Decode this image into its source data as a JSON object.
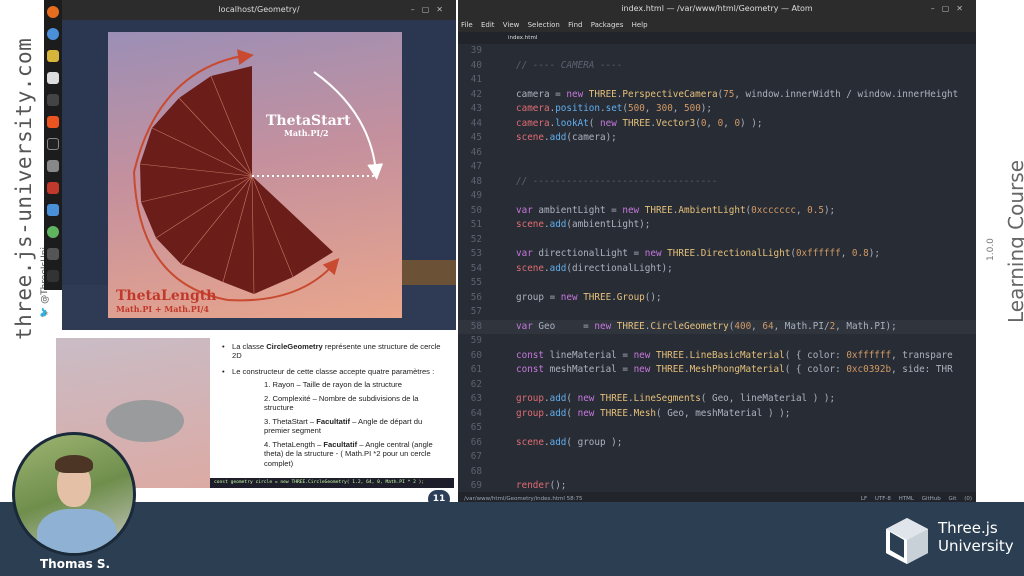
{
  "branding": {
    "left_site": "three.js-university.com",
    "left_handle": "@ThreeJsUni",
    "right_course": "Learning Course",
    "right_version": "1.0.0"
  },
  "browser": {
    "title": "localhost/Geometry/",
    "theta_start_label": "ThetaStart",
    "theta_start_value": "Math.PI/2",
    "theta_length_label": "ThetaLength",
    "theta_length_value": "Math.PI + Math.PI/4",
    "colors": {
      "mesh": "#6b1d19",
      "arrow_red": "#c84a30",
      "arrow_white": "#ffffff"
    }
  },
  "slide": {
    "bullet1_prefix": "La classe ",
    "bullet1_bold": "CircleGeometry",
    "bullet1_suffix": " représente une structure de cercle 2D",
    "bullet2": "Le constructeur de cette classe accepte quatre paramètres :",
    "items": [
      {
        "num": "1.",
        "name": "Rayon",
        "desc": " – Taille de rayon de la structure"
      },
      {
        "num": "2.",
        "name": "Complexité",
        "desc": " – Nombre de subdivisions de la structure"
      },
      {
        "num": "3.",
        "name": "ThetaStart – ",
        "opt": "Facultatif",
        "desc": " – Angle de départ du premier segment"
      },
      {
        "num": "4.",
        "name": "ThetaLength – ",
        "opt": "Facultatif",
        "desc": " – Angle central (angle theta) de la structure - ( Math.PI *2 pour un cercle complet)"
      }
    ],
    "code": "const geometry circle = new THREE.CircleGeometry( 1.2, 64, 0, Math.PI * 2 );",
    "page": "11"
  },
  "atom": {
    "title": "index.html — /var/www/html/Geometry — Atom",
    "menu": [
      "File",
      "Edit",
      "View",
      "Selection",
      "Find",
      "Packages",
      "Help"
    ],
    "tab": "index.html",
    "lines": [
      {
        "n": "39",
        "t": ""
      },
      {
        "n": "40",
        "t": "// ---- CAMERA ----",
        "c": "cm"
      },
      {
        "n": "41",
        "t": ""
      },
      {
        "n": "42",
        "t": "camera = new THREE.PerspectiveCamera(75, window.innerWidth / window.innerHeight"
      },
      {
        "n": "43",
        "t": "camera.position.set(500, 300, 500);"
      },
      {
        "n": "44",
        "t": "camera.lookAt( new THREE.Vector3(0, 0, 0) );"
      },
      {
        "n": "45",
        "t": "scene.add(camera);"
      },
      {
        "n": "46",
        "t": ""
      },
      {
        "n": "47",
        "t": ""
      },
      {
        "n": "48",
        "t": "// ---------------------------------",
        "c": "cm"
      },
      {
        "n": "49",
        "t": ""
      },
      {
        "n": "50",
        "t": "var ambientLight = new THREE.AmbientLight(0xcccccc, 0.5);"
      },
      {
        "n": "51",
        "t": "scene.add(ambientLight);"
      },
      {
        "n": "52",
        "t": ""
      },
      {
        "n": "53",
        "t": "var directionalLight = new THREE.DirectionalLight(0xffffff, 0.8);"
      },
      {
        "n": "54",
        "t": "scene.add(directionalLight);"
      },
      {
        "n": "55",
        "t": ""
      },
      {
        "n": "56",
        "t": "group = new THREE.Group();"
      },
      {
        "n": "57",
        "t": ""
      },
      {
        "n": "58",
        "t": "var Geo     = new THREE.CircleGeometry(400, 64, Math.PI/2, Math.PI);",
        "hl": true
      },
      {
        "n": "59",
        "t": ""
      },
      {
        "n": "60",
        "t": "const lineMaterial = new THREE.LineBasicMaterial( { color: 0xffffff, transpare"
      },
      {
        "n": "61",
        "t": "const meshMaterial = new THREE.MeshPhongMaterial( { color: 0xc0392b, side: THR"
      },
      {
        "n": "62",
        "t": ""
      },
      {
        "n": "63",
        "t": "group.add( new THREE.LineSegments( Geo, lineMaterial ) );"
      },
      {
        "n": "64",
        "t": "group.add( new THREE.Mesh( Geo, meshMaterial ) );"
      },
      {
        "n": "65",
        "t": ""
      },
      {
        "n": "66",
        "t": "scene.add( group );"
      },
      {
        "n": "67",
        "t": ""
      },
      {
        "n": "68",
        "t": ""
      },
      {
        "n": "69",
        "t": "render();"
      },
      {
        "n": "70",
        "t": ""
      }
    ],
    "status_left": "/var/www/html/Geometry/index.html   58:75",
    "status_right": "LF  UTF-8  HTML  GitHub  Git (0)"
  },
  "presenter": {
    "name": "Thomas S."
  },
  "logo": {
    "line1": "Three.js",
    "line2": "University"
  }
}
